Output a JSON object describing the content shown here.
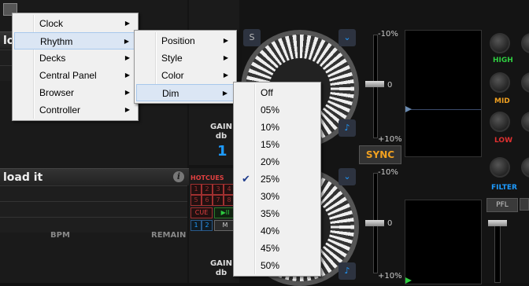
{
  "left_deck": {
    "top_title": "lo",
    "title": "load it",
    "bpm_label": "BPM",
    "remain_label": "REMAIN"
  },
  "strip": {
    "gain_label": "GAIN",
    "db_label": "db",
    "deck_number": "1",
    "hotcues_label": "HOTCUES",
    "hotcue_buttons": [
      "1",
      "2",
      "3",
      "4",
      "5",
      "6",
      "7",
      "8"
    ],
    "cue_label": "CUE",
    "play_label": "▶II",
    "bottom_buttons": [
      "1",
      "2",
      "M"
    ]
  },
  "deck_controls": {
    "s_label": "S",
    "sync_label": "SYNC",
    "pitch_top": "-10%",
    "pitch_zero": "0",
    "pitch_bottom": "+10%",
    "pitch2_top": "-10%",
    "pitch2_zero": "0",
    "pitch2_bottom": "+10%"
  },
  "mixer": {
    "high_label": "HIGH",
    "mid_label": "MID",
    "low_label": "LOW",
    "filter_label": "FILTER",
    "pfl_label": "PFL",
    "colors": {
      "high": "#2ecc40",
      "mid": "#f0a020",
      "low": "#e03030",
      "filter": "#1e9bff"
    }
  },
  "menu_main": {
    "items": [
      {
        "label": "Clock"
      },
      {
        "label": "Rhythm"
      },
      {
        "label": "Decks"
      },
      {
        "label": "Central Panel"
      },
      {
        "label": "Browser"
      },
      {
        "label": "Controller"
      }
    ]
  },
  "menu_rhythm": {
    "items": [
      {
        "label": "Position"
      },
      {
        "label": "Style"
      },
      {
        "label": "Color"
      },
      {
        "label": "Dim"
      }
    ]
  },
  "menu_dim": {
    "selected": "25%",
    "items": [
      {
        "label": "Off"
      },
      {
        "label": "05%"
      },
      {
        "label": "10%"
      },
      {
        "label": "15%"
      },
      {
        "label": "20%"
      },
      {
        "label": "25%"
      },
      {
        "label": "30%"
      },
      {
        "label": "35%"
      },
      {
        "label": "40%"
      },
      {
        "label": "45%"
      },
      {
        "label": "50%"
      }
    ]
  }
}
